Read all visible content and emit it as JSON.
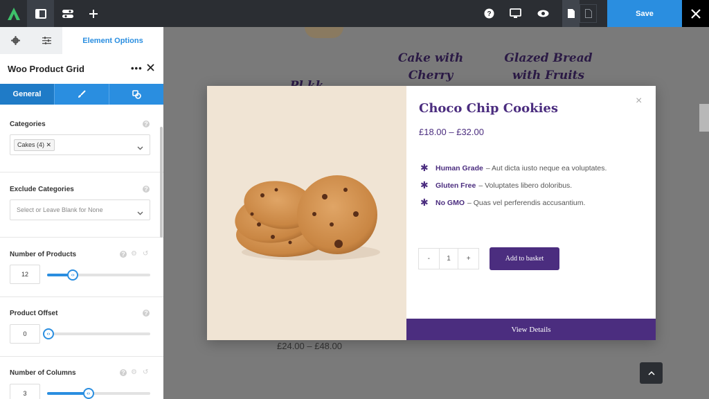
{
  "toolbar": {
    "save_label": "Save"
  },
  "panel": {
    "tab_options_label": "Element Options",
    "title": "Woo Product Grid",
    "dots": "•••",
    "subtabs": {
      "general": "General"
    },
    "categories": {
      "label": "Categories",
      "chip": "Cakes (4) ✕"
    },
    "exclude_categories": {
      "label": "Exclude Categories",
      "placeholder": "Select or Leave Blank for None"
    },
    "number_of_products": {
      "label": "Number of Products",
      "value": "12",
      "slider_fraction": 0.25
    },
    "product_offset": {
      "label": "Product Offset",
      "value": "0",
      "slider_fraction": 0.0
    },
    "number_of_columns": {
      "label": "Number of Columns",
      "value": "3",
      "slider_fraction": 0.4
    }
  },
  "background": {
    "cake_title_1": "Cake with Cherry",
    "cake_title_2": "Glazed Bread with Fruits",
    "partial_title": "Pl   kk",
    "price": "£24.00 – £48.00"
  },
  "modal": {
    "close": "×",
    "title": "Choco Chip Cookies",
    "price": "£18.00 – £32.00",
    "features": [
      {
        "name": "Human Grade",
        "text": "– Aut dicta iusto neque ea voluptates."
      },
      {
        "name": "Gluten Free",
        "text": "– Voluptates libero doloribus."
      },
      {
        "name": "No GMO",
        "text": "– Quas vel perferendis accusantium."
      }
    ],
    "qty_minus": "-",
    "qty_value": "1",
    "qty_plus": "+",
    "add_button": "Add to basket",
    "view_details": "View Details"
  },
  "colors": {
    "accent_blue": "#2a8ee0",
    "brand_purple": "#4b2d7f",
    "topbar": "#2b2e33"
  }
}
